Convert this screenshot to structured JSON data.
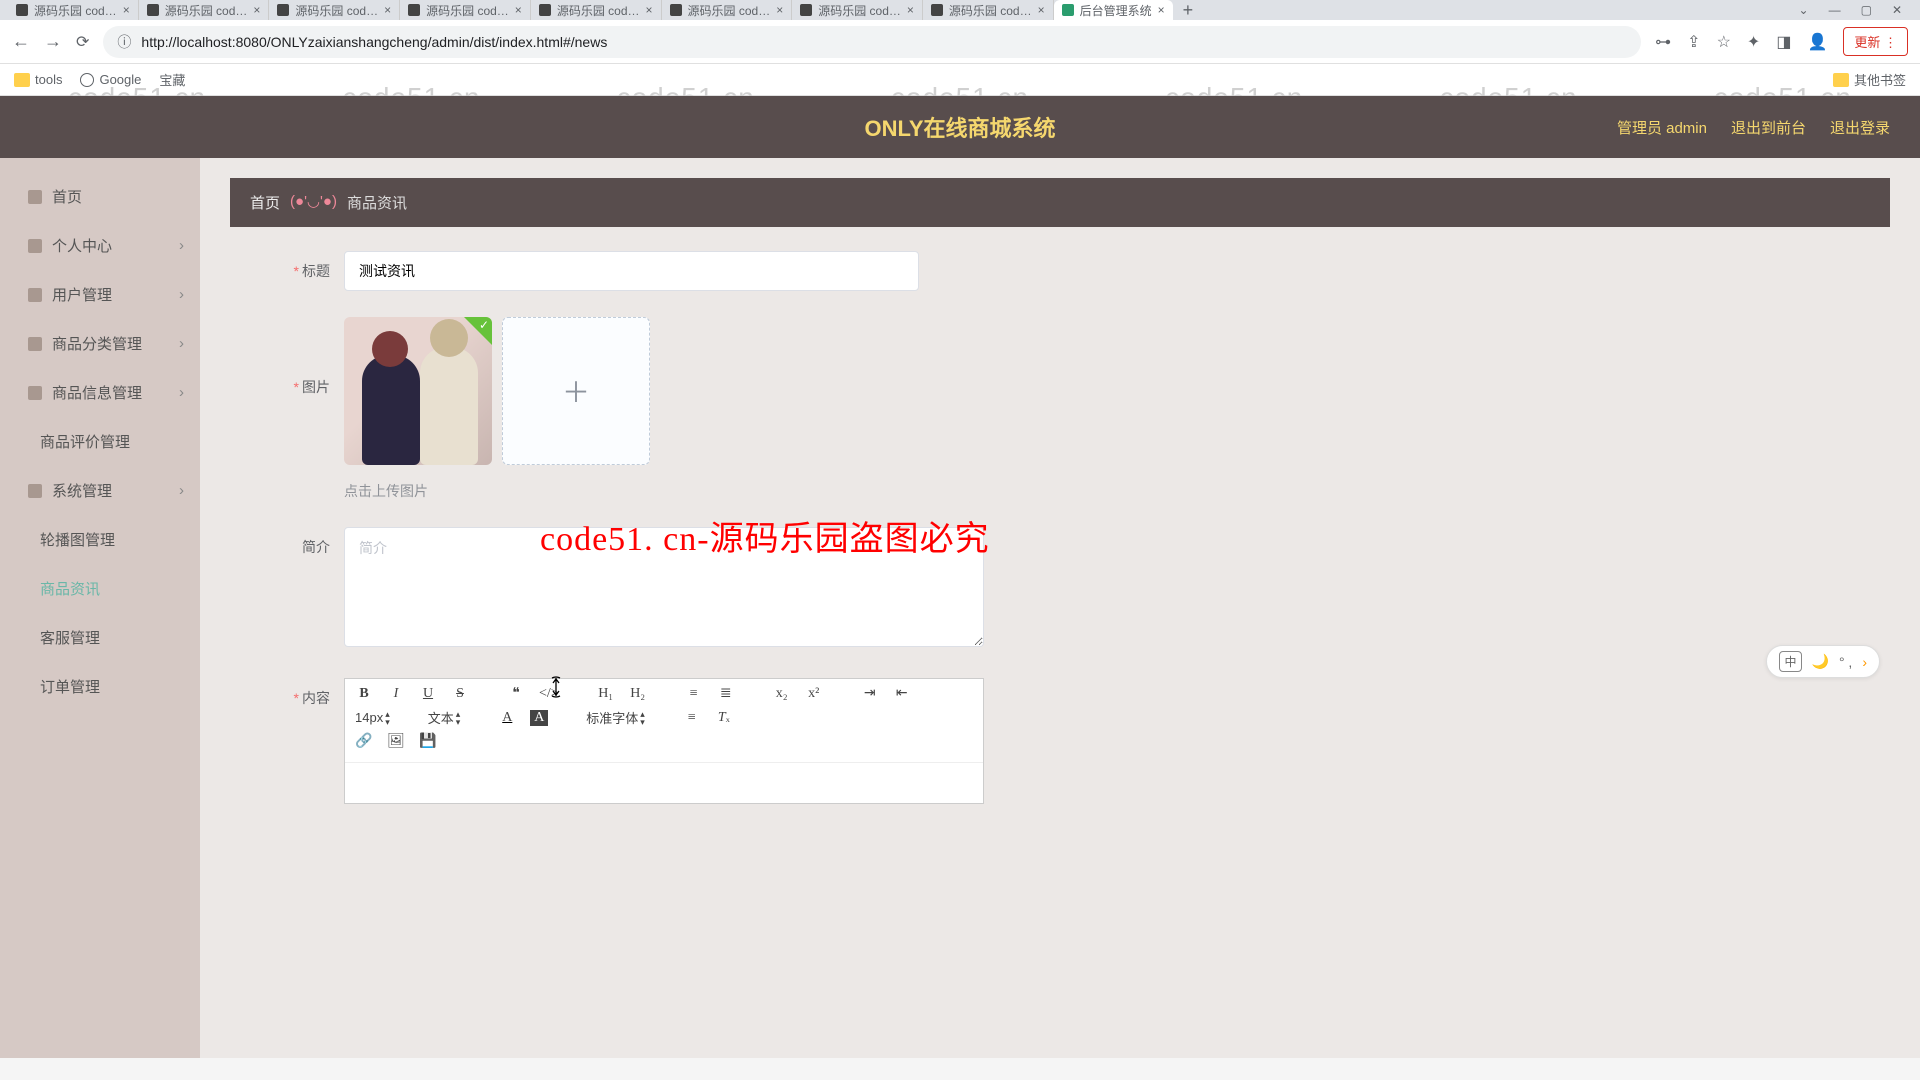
{
  "browser": {
    "tabs": [
      {
        "title": "源码乐园 cod…"
      },
      {
        "title": "源码乐园 cod…"
      },
      {
        "title": "源码乐园 cod…"
      },
      {
        "title": "源码乐园 cod…"
      },
      {
        "title": "源码乐园 cod…"
      },
      {
        "title": "源码乐园 cod…"
      },
      {
        "title": "源码乐园 cod…"
      },
      {
        "title": "源码乐园 cod…"
      },
      {
        "title": "后台管理系统",
        "active": true
      }
    ],
    "url_prefix": "http://",
    "url_host": "localhost",
    "url_path": ":8080/ONLYzaixianshangcheng/admin/dist/index.html#/news",
    "refresh_label": "更新",
    "bookmarks": {
      "tools": "tools",
      "google": "Google",
      "baozang": "宝藏",
      "other": "其他书签"
    }
  },
  "header": {
    "title": "ONLY在线商城系统",
    "user_prefix": "管理员 ",
    "user": "admin",
    "front": "退出到前台",
    "logout": "退出登录"
  },
  "sidebar": {
    "home": "首页",
    "personal": "个人中心",
    "user_mgmt": "用户管理",
    "category_mgmt": "商品分类管理",
    "product_mgmt": "商品信息管理",
    "review_mgmt": "商品评价管理",
    "system_mgmt": "系统管理",
    "carousel_mgmt": "轮播图管理",
    "news": "商品资讯",
    "service_mgmt": "客服管理",
    "order_mgmt": "订单管理"
  },
  "breadcrumb": {
    "home": "首页",
    "face": "(●'◡'●)",
    "current": "商品资讯"
  },
  "form": {
    "title_label": "标题",
    "title_value": "测试资讯",
    "image_label": "图片",
    "upload_hint": "点击上传图片",
    "intro_label": "简介",
    "intro_placeholder": "简介",
    "content_label": "内容"
  },
  "editor": {
    "font_size": "14px",
    "text_style": "文本",
    "font_family": "标准字体"
  },
  "overlay": "code51. cn-源码乐园盗图必究",
  "watermark": "code51.cn",
  "ime": {
    "lang": "中",
    "punct": "° ,"
  }
}
